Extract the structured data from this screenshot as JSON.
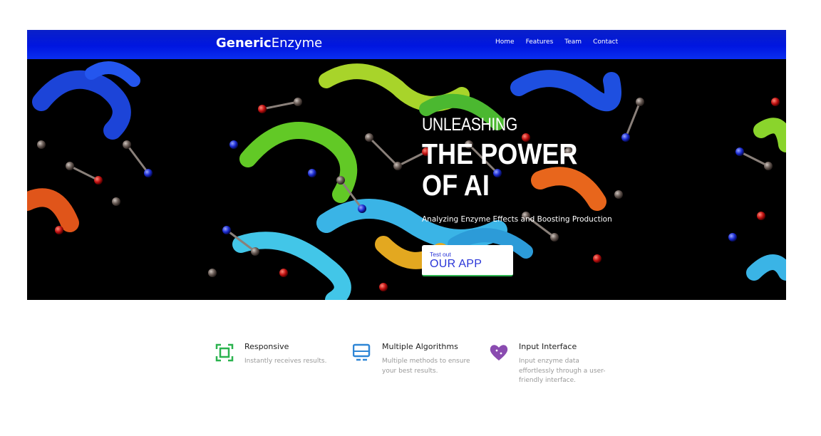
{
  "brand": {
    "bold": "Generic",
    "light": "Enzyme"
  },
  "nav": [
    "Home",
    "Features",
    "Team",
    "Contact"
  ],
  "hero": {
    "subtitle": "UNLEASHING",
    "title": "THE POWER OF AI",
    "tagline": "Analyzing Enzyme Effects and Boosting Production",
    "cta_small": "Test out",
    "cta_big": "OUR APP"
  },
  "features": [
    {
      "icon": "responsive-frame-icon",
      "title": "Responsive",
      "desc": "Instantly receives results.",
      "color": "#2bb34f"
    },
    {
      "icon": "monitor-icon",
      "title": "Multiple Algorithms",
      "desc": "Multiple methods to ensure your best results.",
      "color": "#2f86d6"
    },
    {
      "icon": "heart-icon",
      "title": "Input Interface",
      "desc": "Input enzyme data effortlessly through a user-friendly interface.",
      "color": "#8a4bb0"
    }
  ],
  "colors": {
    "nav_bg": "#0016e0",
    "cta_text": "#2a36d8",
    "cta_border": "#2bb34f"
  }
}
